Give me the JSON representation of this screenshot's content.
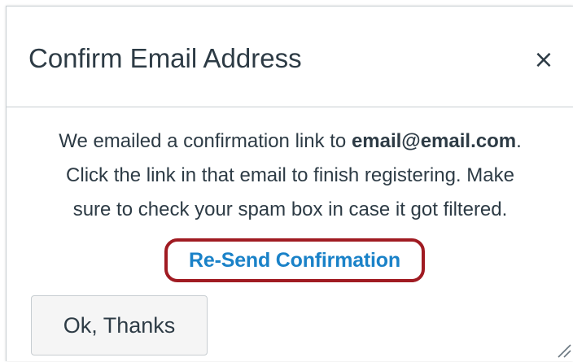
{
  "dialog": {
    "title": "Confirm Email Address",
    "close_label": "×",
    "message": {
      "line1_prefix": "We emailed a confirmation link to ",
      "email": "email@email.com",
      "line1_suffix": ".",
      "line2": "Click the link in that email to finish registering. Make",
      "line3": "sure to check your spam box in case it got filtered."
    },
    "resend_label": "Re-Send Confirmation",
    "ok_label": "Ok, Thanks"
  },
  "colors": {
    "text": "#2d3b45",
    "link": "#1a82c8",
    "highlight_border": "#a01b22",
    "divider": "#c7cdd1",
    "button_bg": "#f5f5f5"
  },
  "icons": {
    "close": "close-icon",
    "resize": "resize-handle-icon"
  }
}
